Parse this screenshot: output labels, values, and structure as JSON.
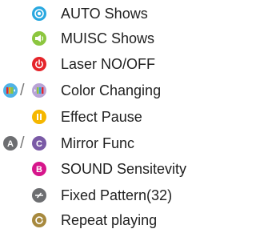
{
  "items": [
    {
      "label": "AUTO  Shows",
      "icon": "auto-show-icon",
      "color": "#29a8e0"
    },
    {
      "label": "MUISC Shows",
      "icon": "music-show-icon",
      "color": "#8cc63f"
    },
    {
      "label": "Laser NO/OFF",
      "icon": "power-icon",
      "color": "#e5242a"
    },
    {
      "label": "Color Changing",
      "icon_left": "color-prev-icon",
      "icon_right": "color-next-icon",
      "color_left": "#4fb3e6",
      "color_right": "#b9a3d6",
      "separator": "/"
    },
    {
      "label": "Effect Pause",
      "icon": "pause-icon",
      "color": "#f5b700"
    },
    {
      "label": "Mirror Func",
      "icon_left": "mirror-a-icon",
      "icon_right": "mirror-c-icon",
      "color_left": "#6d6e71",
      "color_right": "#7a5aa6",
      "letter_left": "A",
      "letter_right": "C",
      "separator": "/"
    },
    {
      "label": "SOUND Sensitevity",
      "icon": "sound-b-icon",
      "color": "#d6168b",
      "letter": "B"
    },
    {
      "label": "Fixed Pattern(32)",
      "icon": "fixed-pattern-icon",
      "color": "#6d6e71"
    },
    {
      "label": "Repeat playing",
      "icon": "repeat-icon",
      "color": "#a7893e"
    }
  ]
}
